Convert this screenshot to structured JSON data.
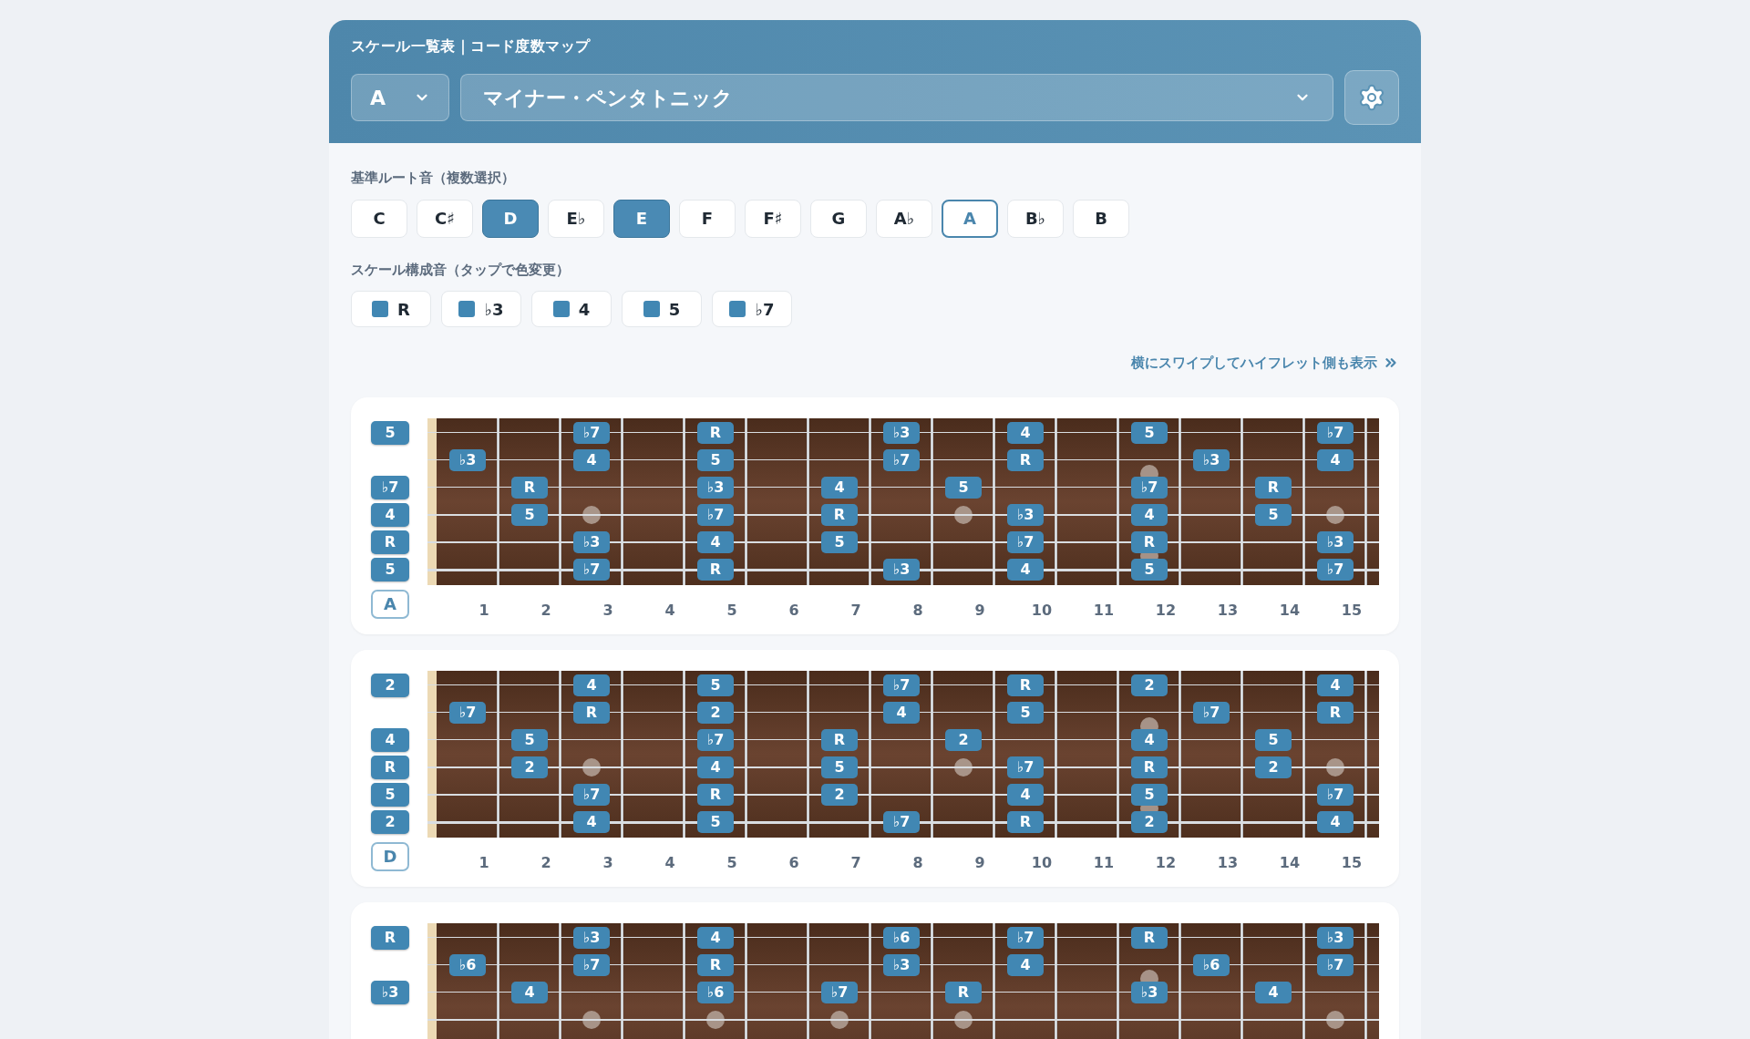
{
  "header": {
    "title": "スケール一覧表｜コード度数マップ",
    "key_select": {
      "value": "A"
    },
    "scale_select": {
      "value": "マイナー・ペンタトニック"
    }
  },
  "root_section": {
    "label": "基準ルート音（複数選択）",
    "notes": [
      {
        "label": "C",
        "selected": false,
        "current": false
      },
      {
        "label": "C♯",
        "selected": false,
        "current": false
      },
      {
        "label": "D",
        "selected": true,
        "current": false
      },
      {
        "label": "E♭",
        "selected": false,
        "current": false
      },
      {
        "label": "E",
        "selected": true,
        "current": false
      },
      {
        "label": "F",
        "selected": false,
        "current": false
      },
      {
        "label": "F♯",
        "selected": false,
        "current": false
      },
      {
        "label": "G",
        "selected": false,
        "current": false
      },
      {
        "label": "A♭",
        "selected": false,
        "current": false
      },
      {
        "label": "A",
        "selected": false,
        "current": true
      },
      {
        "label": "B♭",
        "selected": false,
        "current": false
      },
      {
        "label": "B",
        "selected": false,
        "current": false
      }
    ]
  },
  "tones_section": {
    "label": "スケール構成音（タップで色変更）",
    "tones": [
      {
        "label": "R",
        "color": "#4187b3"
      },
      {
        "label": "♭3",
        "color": "#4187b3"
      },
      {
        "label": "4",
        "color": "#4187b3"
      },
      {
        "label": "5",
        "color": "#4187b3"
      },
      {
        "label": "♭7",
        "color": "#4187b3"
      }
    ]
  },
  "swipe_hint": "横にスワイプしてハイフレット側も表示",
  "boards": [
    {
      "root": "A",
      "fret_numbers": [
        "1",
        "2",
        "3",
        "4",
        "5",
        "6",
        "7",
        "8",
        "9",
        "10",
        "11",
        "12",
        "13",
        "14",
        "15"
      ],
      "strings": [
        {
          "frets": {
            "0": "5",
            "3": "♭7",
            "5": "R",
            "8": "♭3",
            "10": "4",
            "12": "5",
            "15": "♭7"
          }
        },
        {
          "frets": {
            "1": "♭3",
            "3": "4",
            "5": "5",
            "8": "♭7",
            "10": "R",
            "13": "♭3",
            "15": "4"
          }
        },
        {
          "frets": {
            "0": "♭7",
            "2": "R",
            "5": "♭3",
            "7": "4",
            "9": "5",
            "12": "♭7",
            "14": "R"
          }
        },
        {
          "frets": {
            "0": "4",
            "2": "5",
            "5": "♭7",
            "7": "R",
            "10": "♭3",
            "12": "4",
            "14": "5"
          }
        },
        {
          "frets": {
            "0": "R",
            "3": "♭3",
            "5": "4",
            "7": "5",
            "10": "♭7",
            "12": "R",
            "15": "♭3"
          }
        },
        {
          "frets": {
            "0": "5",
            "3": "♭7",
            "5": "R",
            "8": "♭3",
            "10": "4",
            "12": "5",
            "15": "♭7"
          }
        }
      ]
    },
    {
      "root": "D",
      "fret_numbers": [
        "1",
        "2",
        "3",
        "4",
        "5",
        "6",
        "7",
        "8",
        "9",
        "10",
        "11",
        "12",
        "13",
        "14",
        "15"
      ],
      "strings": [
        {
          "frets": {
            "0": "2",
            "3": "4",
            "5": "5",
            "8": "♭7",
            "10": "R",
            "12": "2",
            "15": "4"
          }
        },
        {
          "frets": {
            "1": "♭7",
            "3": "R",
            "5": "2",
            "8": "4",
            "10": "5",
            "13": "♭7",
            "15": "R"
          }
        },
        {
          "frets": {
            "0": "4",
            "2": "5",
            "5": "♭7",
            "7": "R",
            "9": "2",
            "12": "4",
            "14": "5"
          }
        },
        {
          "frets": {
            "0": "R",
            "2": "2",
            "5": "4",
            "7": "5",
            "10": "♭7",
            "12": "R",
            "14": "2"
          }
        },
        {
          "frets": {
            "0": "5",
            "3": "♭7",
            "5": "R",
            "7": "2",
            "10": "4",
            "12": "5",
            "15": "♭7"
          }
        },
        {
          "frets": {
            "0": "2",
            "3": "4",
            "5": "5",
            "8": "♭7",
            "10": "R",
            "12": "2",
            "15": "4"
          }
        }
      ]
    },
    {
      "strings": [
        {
          "frets": {
            "0": "R",
            "3": "♭3",
            "5": "4",
            "8": "♭6",
            "10": "♭7",
            "12": "R",
            "15": "♭3"
          }
        },
        {
          "frets": {
            "1": "♭6",
            "3": "♭7",
            "5": "R",
            "8": "♭3",
            "10": "4",
            "13": "♭6",
            "15": "♭7"
          }
        },
        {
          "frets": {
            "0": "♭3",
            "2": "4",
            "5": "♭6",
            "7": "♭7",
            "9": "R",
            "12": "♭3",
            "14": "4"
          }
        }
      ]
    }
  ]
}
